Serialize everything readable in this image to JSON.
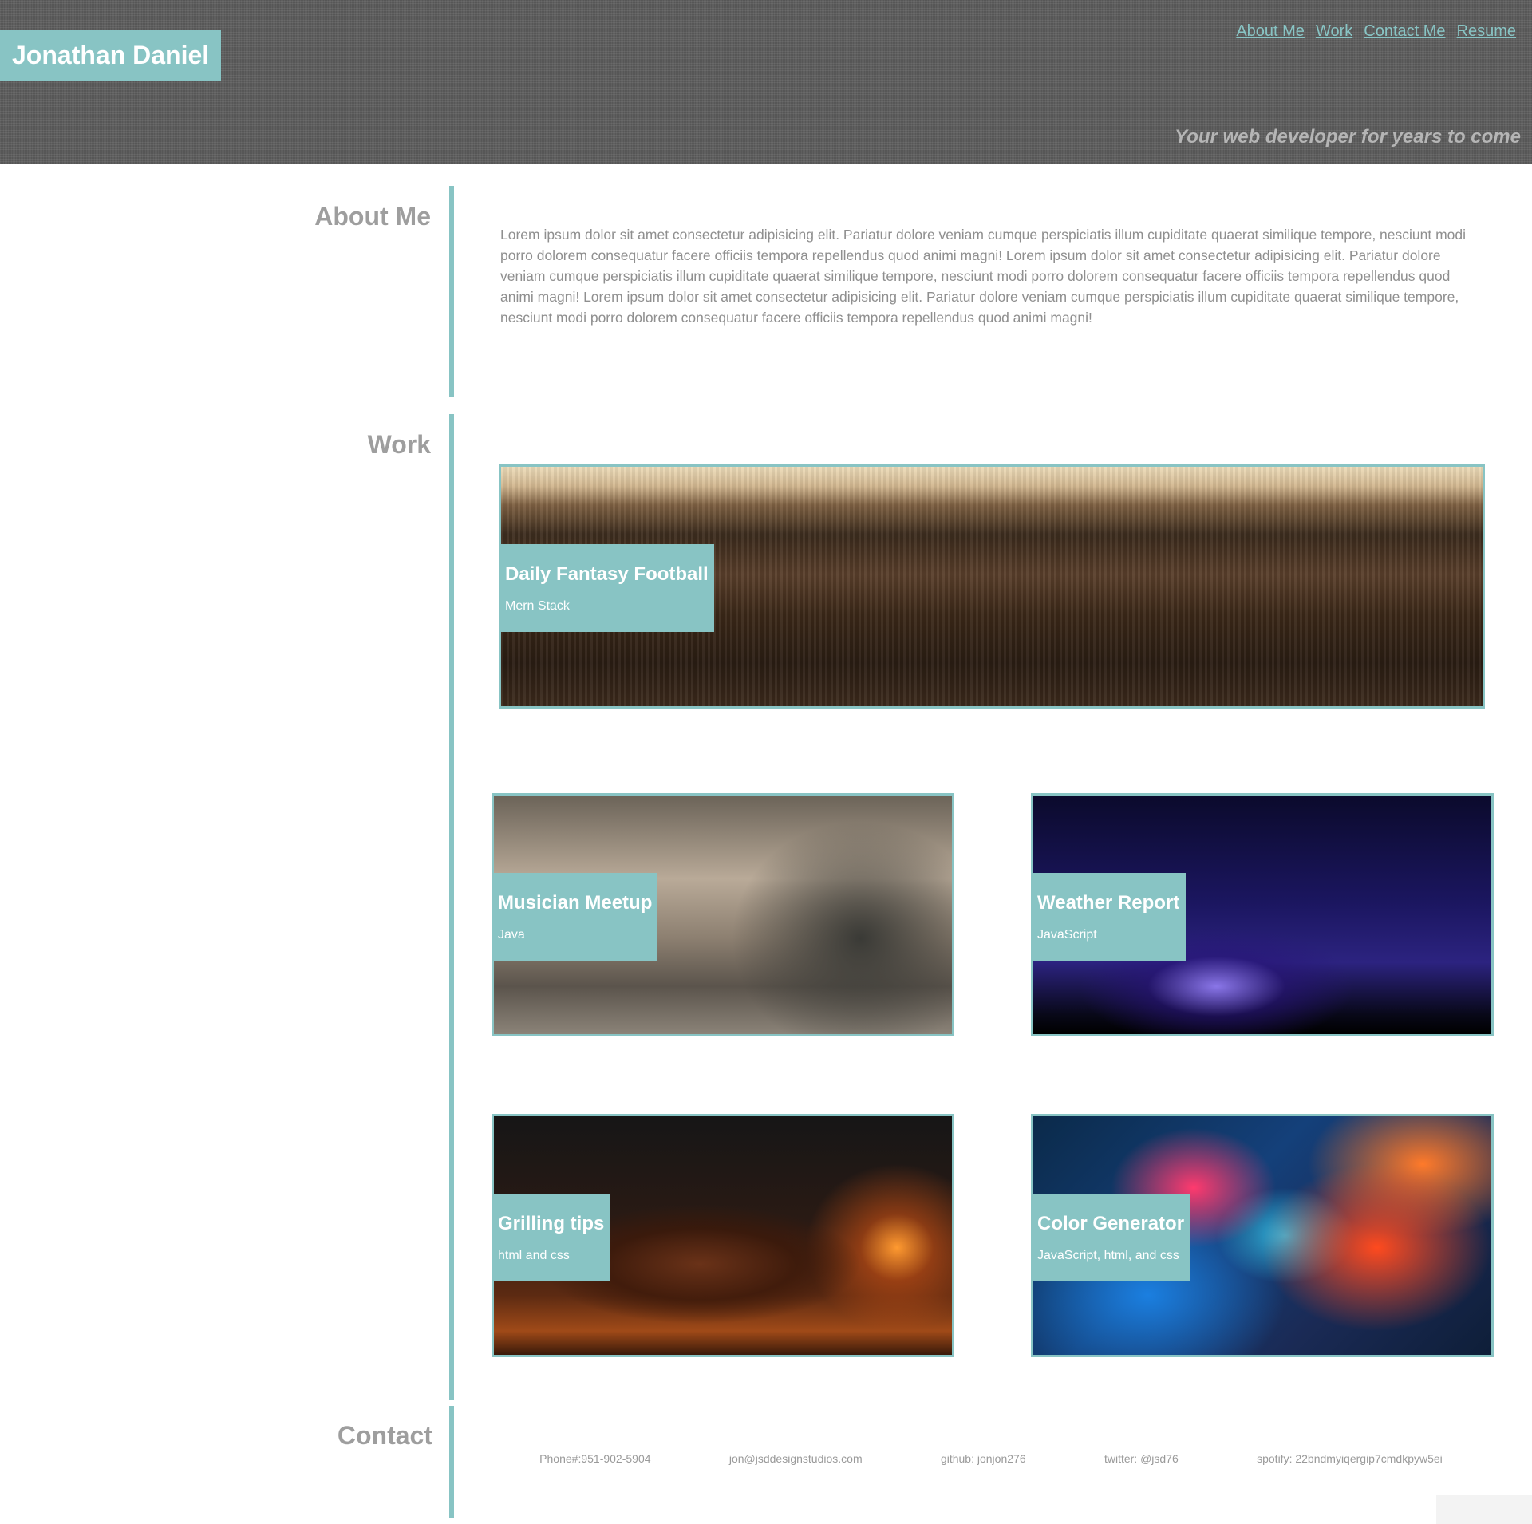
{
  "header": {
    "brand": "Jonathan Daniel",
    "nav": [
      "About Me",
      "Work ",
      "Contact Me",
      "Resume"
    ],
    "tagline": "Your web developer for years to come"
  },
  "about": {
    "title": "About Me",
    "text": "Lorem ipsum dolor sit amet consectetur adipisicing elit. Pariatur dolore veniam cumque perspiciatis illum cupiditate quaerat similique tempore, nesciunt modi porro dolorem consequatur facere officiis tempora repellendus quod animi magni! Lorem ipsum dolor sit amet consectetur adipisicing elit. Pariatur dolore veniam cumque perspiciatis illum cupiditate quaerat similique tempore, nesciunt modi porro dolorem consequatur facere officiis tempora repellendus quod animi magni! Lorem ipsum dolor sit amet consectetur adipisicing elit. Pariatur dolore veniam cumque perspiciatis illum cupiditate quaerat similique tempore, nesciunt modi porro dolorem consequatur facere officiis tempora repellendus quod animi magni!"
  },
  "work": {
    "title": "Work",
    "projects": [
      {
        "title": "Daily Fantasy Football",
        "tech": "Mern Stack",
        "image": "stadium-crowd"
      },
      {
        "title": "Musician Meetup",
        "tech": "Java",
        "image": "band-concert"
      },
      {
        "title": "Weather Report",
        "tech": "JavaScript",
        "image": "lightning-storm"
      },
      {
        "title": "Grilling tips",
        "tech": "html and css",
        "image": "grilled-steak"
      },
      {
        "title": "Color Generator",
        "tech": "JavaScript, html, and css",
        "image": "color-ink-smoke"
      }
    ]
  },
  "contact": {
    "title": "Contact",
    "items": [
      "Phone#:951-902-5904",
      "jon@jsddesignstudios.com",
      "github: jonjon276",
      "twitter: @jsd76",
      "spotify: 22bndmyiqergip7cmdkpyw5ei"
    ]
  },
  "colors": {
    "accent": "#88c4c4",
    "header_bg": "#5f5f5f",
    "heading_gray": "#9e9e9e",
    "body_text": "#8f8f8f"
  }
}
